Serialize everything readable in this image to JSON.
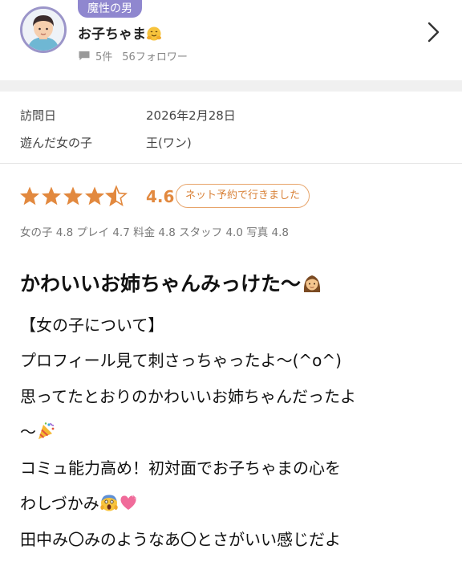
{
  "reviewer": {
    "tag": "魔性の男",
    "name": "お子ちゃま",
    "review_count": "5件",
    "followers": "56フォロワー"
  },
  "visit": {
    "date_label": "訪問日",
    "date_value": "2026年2月28日",
    "girl_label": "遊んだ女の子",
    "girl_value": "王(ワン)"
  },
  "rating": {
    "stars": 4.5,
    "score": "4.6",
    "badge": "ネット予約で行きました",
    "breakdown": "女の子 4.8 プレイ 4.7 料金 4.8 スタッフ 4.0 写真 4.8"
  },
  "review": {
    "title": "かわいいお姉ちゃんみっけた〜",
    "lines": [
      "【女の子について】",
      "プロフィール見て刺さっちゃったよ〜(^o^)",
      "思ってたとおりのかわいいお姉ちゃんだったよ",
      "〜",
      "コミュ能力高め！初対面でお子ちゃまの心を",
      "わしづかみ",
      "田中み〇みのようなあ〇とさがいい感じだよ"
    ]
  },
  "colors": {
    "accent_orange": "#e2893f",
    "tag_purple": "#8f87cf"
  },
  "icons": [
    "avatar-icon",
    "hug-emoji-icon",
    "chat-icon",
    "chevron-right-icon",
    "star-icon",
    "woman-emoji-icon",
    "confetti-emoji-icon",
    "scream-emoji-icon",
    "heart-emoji-icon"
  ]
}
